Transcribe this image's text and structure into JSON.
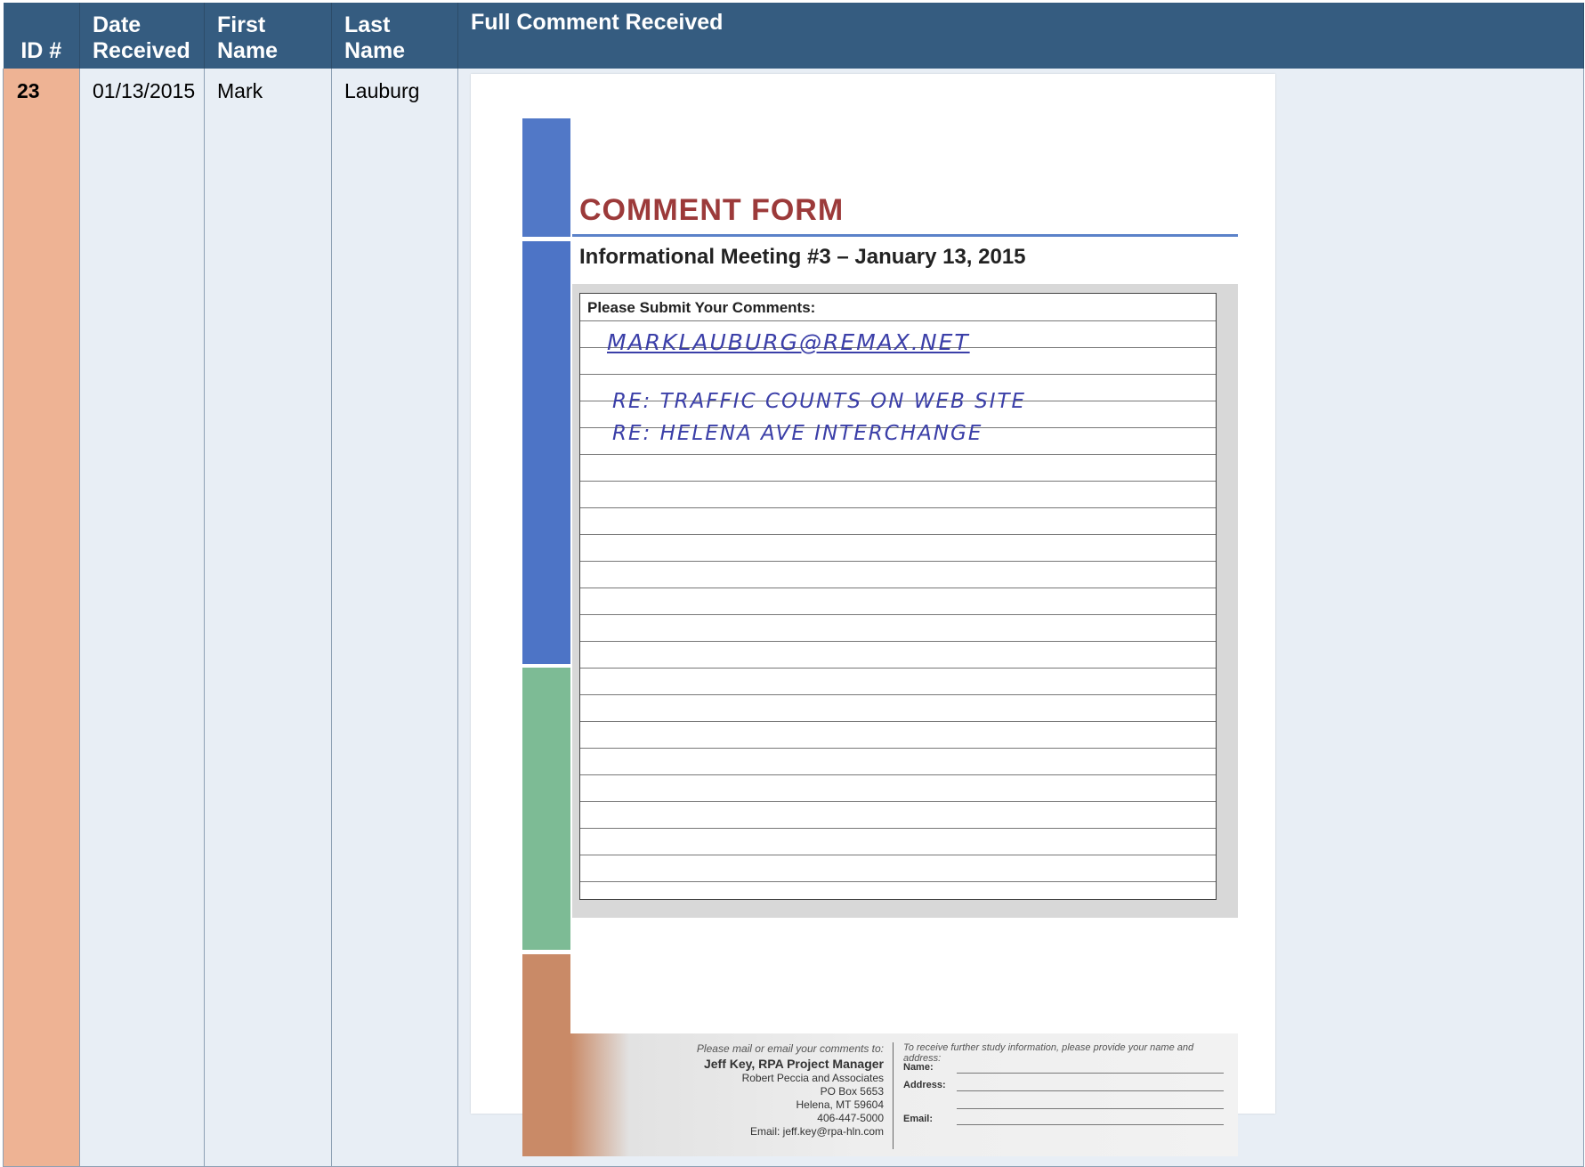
{
  "table": {
    "headers": {
      "id": "ID #",
      "date_l1": "Date",
      "date_l2": "Received",
      "first_l1": "First",
      "first_l2": "Name",
      "last_l1": "Last",
      "last_l2": "Name",
      "comment": "Full Comment Received"
    },
    "row": {
      "id": "23",
      "date": "01/13/2015",
      "first": "Mark",
      "last": "Lauburg"
    }
  },
  "form": {
    "title": "COMMENT FORM",
    "subtitle": "Informational Meeting #3 – January 13, 2015",
    "box_label": "Please Submit Your Comments:",
    "handwriting": {
      "line1": "MARKLAUBURG@REMAX.NET",
      "line2": "RE: TRAFFIC COUNTS ON WEB SITE",
      "line3": "RE: HELENA AVE INTERCHANGE"
    },
    "footer": {
      "mail_prompt": "Please mail or email your comments to:",
      "contact_name": "Jeff Key, RPA Project Manager",
      "company": "Robert Peccia and Associates",
      "po_box": "PO Box 5653",
      "city": "Helena, MT 59604",
      "phone": "406-447-5000",
      "email": "Email: jeff.key@rpa-hln.com",
      "info_prompt": "To receive further study information, please provide your name and address:",
      "name_label": "Name:",
      "address_label": "Address:",
      "email_label": "Email:"
    },
    "colors": {
      "blue_bar": "#5178c7",
      "green_bar": "#7dbb95",
      "orange_bar": "#c98a67",
      "title_red": "#9c3a3a",
      "ink_blue": "#3b3fa8"
    }
  }
}
